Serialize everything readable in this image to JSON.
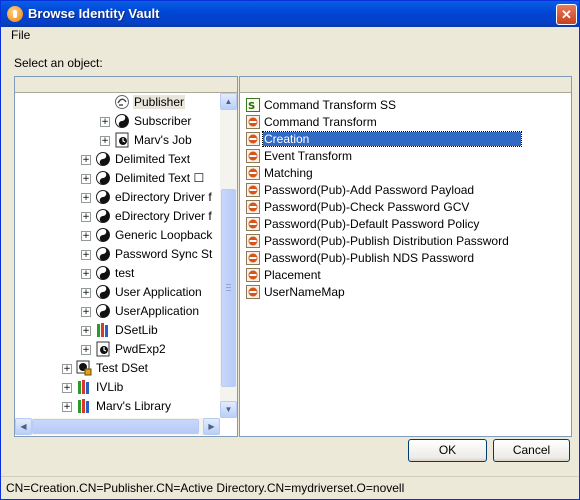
{
  "window": {
    "title": "Browse Identity Vault",
    "close_label": "✕"
  },
  "menu": {
    "file": "File"
  },
  "prompt": "Select an object:",
  "tree": [
    {
      "label": "Publisher",
      "icon": "publisher-icon",
      "expander": "",
      "selected": true
    },
    {
      "label": "Subscriber",
      "icon": "subscriber-icon",
      "expander": "+"
    },
    {
      "label": "Marv's Job",
      "icon": "job-icon",
      "expander": "+"
    },
    {
      "label": "Delimited Text",
      "icon": "driver-icon",
      "expander": "+"
    },
    {
      "label": "Delimited Text ☐",
      "icon": "driver-icon",
      "expander": "+"
    },
    {
      "label": "eDirectory Driver f",
      "icon": "driver-icon",
      "expander": "+"
    },
    {
      "label": "eDirectory Driver f",
      "icon": "driver-icon",
      "expander": "+"
    },
    {
      "label": "Generic Loopback",
      "icon": "driver-icon",
      "expander": "+"
    },
    {
      "label": "Password Sync St",
      "icon": "driver-icon",
      "expander": "+"
    },
    {
      "label": "test",
      "icon": "driver-icon",
      "expander": "+"
    },
    {
      "label": "User Application",
      "icon": "driver-icon",
      "expander": "+"
    },
    {
      "label": "UserApplication",
      "icon": "driver-icon",
      "expander": "+"
    },
    {
      "label": "DSetLib",
      "icon": "library-icon",
      "expander": "+"
    },
    {
      "label": "PwdExp2",
      "icon": "job-icon",
      "expander": "+"
    },
    {
      "label": "Test DSet",
      "icon": "driverset-icon",
      "expander": "+"
    },
    {
      "label": "IVLib",
      "icon": "library-icon",
      "expander": "+"
    },
    {
      "label": "Marv's Library",
      "icon": "library-icon",
      "expander": "+"
    }
  ],
  "list": [
    {
      "label": "Command Transform SS",
      "icon": "stylesheet-icon"
    },
    {
      "label": "Command Transform",
      "icon": "policy-icon"
    },
    {
      "label": "Creation",
      "icon": "policy-icon",
      "selected": true
    },
    {
      "label": "Event Transform",
      "icon": "policy-icon"
    },
    {
      "label": "Matching",
      "icon": "policy-icon"
    },
    {
      "label": "Password(Pub)-Add Password Payload",
      "icon": "policy-icon"
    },
    {
      "label": "Password(Pub)-Check Password GCV",
      "icon": "policy-icon"
    },
    {
      "label": "Password(Pub)-Default Password Policy",
      "icon": "policy-icon"
    },
    {
      "label": "Password(Pub)-Publish Distribution Password",
      "icon": "policy-icon"
    },
    {
      "label": "Password(Pub)-Publish NDS Password",
      "icon": "policy-icon"
    },
    {
      "label": "Placement",
      "icon": "policy-icon"
    },
    {
      "label": "UserNameMap",
      "icon": "policy-icon"
    }
  ],
  "buttons": {
    "ok": "OK",
    "cancel": "Cancel"
  },
  "status": "CN=Creation.CN=Publisher.CN=Active Directory.CN=mydriverset.O=novell",
  "colors": {
    "selection": "#316ac5",
    "titlebar": "#0047d6"
  }
}
